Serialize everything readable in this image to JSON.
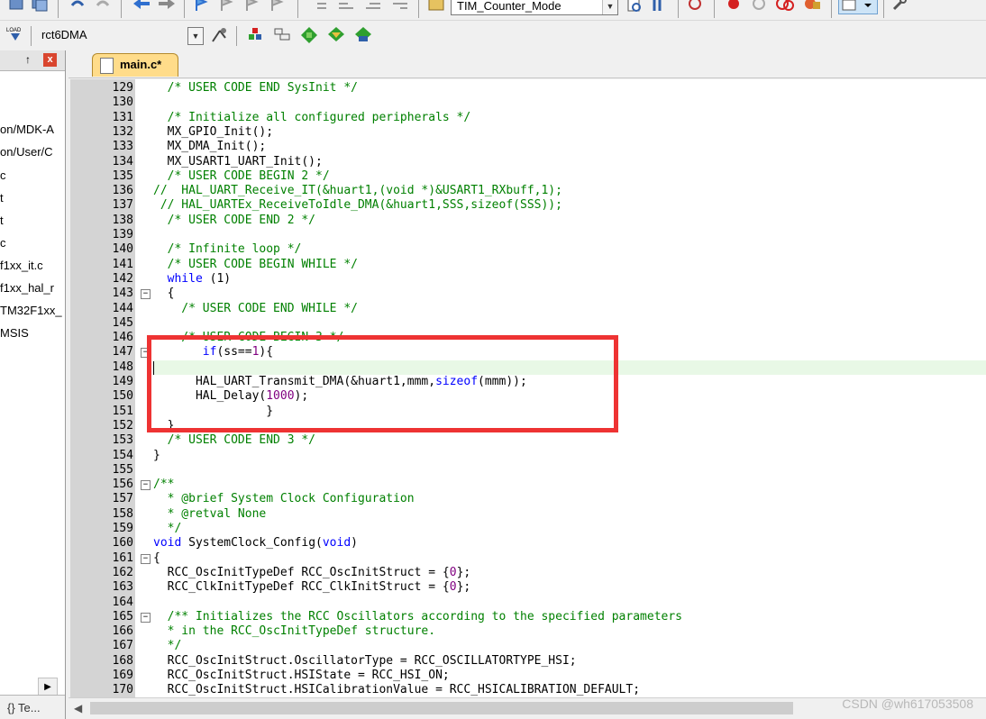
{
  "toolbar": {
    "target_combo": "TIM_Counter_Mode",
    "project_combo": "rct6DMA",
    "load_label": "LOAD"
  },
  "left_panel": {
    "pin_glyph": "↑",
    "close_glyph": "x",
    "items": [
      "on/MDK-A",
      "on/User/C",
      "c",
      "t",
      "t",
      "c",
      "f1xx_it.c",
      "f1xx_hal_r",
      "TM32F1xx_",
      "MSIS"
    ],
    "bottom_tab": "{}​ Te..."
  },
  "editor": {
    "tab_label": "main.c*",
    "lines": [
      {
        "n": "129",
        "segs": [
          [
            "cmt",
            "  /* USER CODE END SysInit */"
          ]
        ]
      },
      {
        "n": "130",
        "segs": []
      },
      {
        "n": "131",
        "segs": [
          [
            "cmt",
            "  /* Initialize all configured peripherals */"
          ]
        ]
      },
      {
        "n": "132",
        "segs": [
          [
            "plain",
            "  MX_GPIO_Init();"
          ]
        ]
      },
      {
        "n": "133",
        "segs": [
          [
            "plain",
            "  MX_DMA_Init();"
          ]
        ]
      },
      {
        "n": "134",
        "segs": [
          [
            "plain",
            "  MX_USART1_UART_Init();"
          ]
        ]
      },
      {
        "n": "135",
        "segs": [
          [
            "cmt",
            "  /* USER CODE BEGIN 2 */"
          ]
        ]
      },
      {
        "n": "136",
        "segs": [
          [
            "cmt",
            "//  HAL_UART_Receive_IT(&huart1,(void *)&USART1_RXbuff,1);"
          ]
        ]
      },
      {
        "n": "137",
        "segs": [
          [
            "cmt",
            " // HAL_UARTEx_ReceiveToIdle_DMA(&huart1,SSS,sizeof(SSS));"
          ]
        ]
      },
      {
        "n": "138",
        "segs": [
          [
            "cmt",
            "  /* USER CODE END 2 */"
          ]
        ]
      },
      {
        "n": "139",
        "segs": []
      },
      {
        "n": "140",
        "segs": [
          [
            "cmt",
            "  /* Infinite loop */"
          ]
        ]
      },
      {
        "n": "141",
        "segs": [
          [
            "cmt",
            "  /* USER CODE BEGIN WHILE */"
          ]
        ]
      },
      {
        "n": "142",
        "segs": [
          [
            "kw",
            "  while"
          ],
          [
            "plain",
            " (1)"
          ]
        ]
      },
      {
        "n": "143",
        "segs": [
          [
            "plain",
            "  {"
          ]
        ]
      },
      {
        "n": "144",
        "segs": [
          [
            "cmt",
            "    /* USER CODE END WHILE */"
          ]
        ]
      },
      {
        "n": "145",
        "segs": []
      },
      {
        "n": "146",
        "segs": [
          [
            "cmt",
            "    /* USER CODE BEGIN 3 */"
          ]
        ]
      },
      {
        "n": "147",
        "segs": [
          [
            "kw",
            "       if"
          ],
          [
            "plain",
            "(ss=="
          ],
          [
            "num",
            "1"
          ],
          [
            "plain",
            "){"
          ]
        ]
      },
      {
        "n": "148",
        "segs": []
      },
      {
        "n": "149",
        "segs": [
          [
            "plain",
            "      HAL_UART_Transmit_DMA(&huart1,mmm,"
          ],
          [
            "kw",
            "sizeof"
          ],
          [
            "plain",
            "(mmm));"
          ]
        ]
      },
      {
        "n": "150",
        "segs": [
          [
            "plain",
            "      HAL_Delay("
          ],
          [
            "num",
            "1000"
          ],
          [
            "plain",
            ");"
          ]
        ]
      },
      {
        "n": "151",
        "segs": [
          [
            "plain",
            "                }"
          ]
        ]
      },
      {
        "n": "152",
        "segs": [
          [
            "plain",
            "  }"
          ]
        ]
      },
      {
        "n": "153",
        "segs": [
          [
            "cmt",
            "  /* USER CODE END 3 */"
          ]
        ]
      },
      {
        "n": "154",
        "segs": [
          [
            "plain",
            "}"
          ]
        ]
      },
      {
        "n": "155",
        "segs": []
      },
      {
        "n": "156",
        "segs": [
          [
            "cmt",
            "/**"
          ]
        ]
      },
      {
        "n": "157",
        "segs": [
          [
            "cmt",
            "  * @brief System Clock Configuration"
          ]
        ]
      },
      {
        "n": "158",
        "segs": [
          [
            "cmt",
            "  * @retval None"
          ]
        ]
      },
      {
        "n": "159",
        "segs": [
          [
            "cmt",
            "  */"
          ]
        ]
      },
      {
        "n": "160",
        "segs": [
          [
            "kw",
            "void"
          ],
          [
            "plain",
            " SystemClock_Config("
          ],
          [
            "kw",
            "void"
          ],
          [
            "plain",
            ")"
          ]
        ]
      },
      {
        "n": "161",
        "segs": [
          [
            "plain",
            "{"
          ]
        ]
      },
      {
        "n": "162",
        "segs": [
          [
            "plain",
            "  RCC_OscInitTypeDef RCC_OscInitStruct = {"
          ],
          [
            "num",
            "0"
          ],
          [
            "plain",
            "};"
          ]
        ]
      },
      {
        "n": "163",
        "segs": [
          [
            "plain",
            "  RCC_ClkInitTypeDef RCC_ClkInitStruct = {"
          ],
          [
            "num",
            "0"
          ],
          [
            "plain",
            "};"
          ]
        ]
      },
      {
        "n": "164",
        "segs": []
      },
      {
        "n": "165",
        "segs": [
          [
            "cmt",
            "  /** Initializes the RCC Oscillators according to the specified parameters"
          ]
        ]
      },
      {
        "n": "166",
        "segs": [
          [
            "cmt",
            "  * in the RCC_OscInitTypeDef structure."
          ]
        ]
      },
      {
        "n": "167",
        "segs": [
          [
            "cmt",
            "  */"
          ]
        ]
      },
      {
        "n": "168",
        "segs": [
          [
            "plain",
            "  RCC_OscInitStruct.OscillatorType = RCC_OSCILLATORTYPE_HSI;"
          ]
        ]
      },
      {
        "n": "169",
        "segs": [
          [
            "plain",
            "  RCC_OscInitStruct.HSIState = RCC_HSI_ON;"
          ]
        ]
      },
      {
        "n": "170",
        "segs": [
          [
            "plain",
            "  RCC_OscInitStruct.HSICalibrationValue = RCC_HSICALIBRATION_DEFAULT;"
          ]
        ]
      }
    ]
  },
  "watermark": "CSDN @wh617053508"
}
